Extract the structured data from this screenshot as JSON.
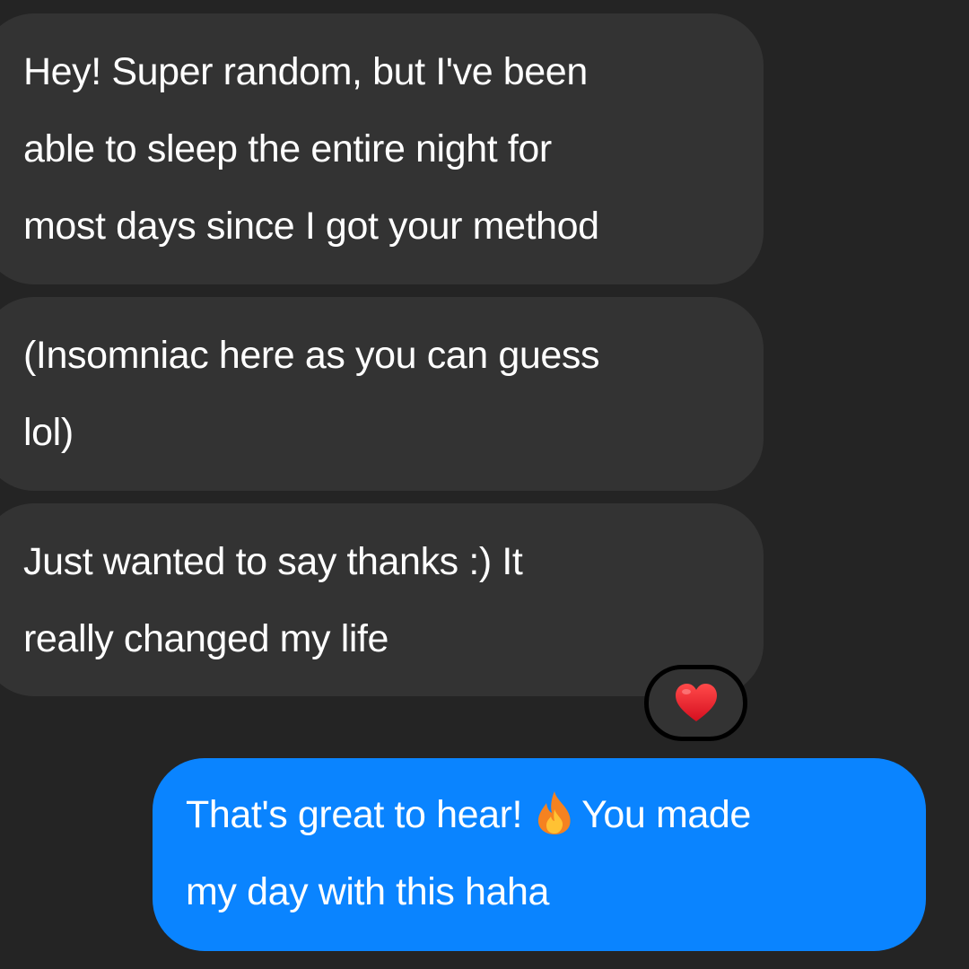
{
  "conversation": {
    "messages": [
      {
        "direction": "incoming",
        "lines": [
          "Hey! Super random, but I've been",
          "able to sleep the entire night for",
          "most days since I got your method"
        ]
      },
      {
        "direction": "incoming",
        "lines": [
          "(Insomniac here as you can guess",
          "lol)"
        ]
      },
      {
        "direction": "incoming",
        "lines": [
          "Just wanted to say thanks :) It",
          "really changed my life"
        ],
        "reaction": {
          "icon": "red-heart-icon"
        }
      },
      {
        "direction": "outgoing",
        "line1_before": "That's great to hear!",
        "line1_icon": "fire-icon",
        "line1_after": "You made",
        "line2": "my day with this haha"
      }
    ]
  },
  "colors": {
    "background": "#242424",
    "incoming_bubble": "#333333",
    "outgoing_bubble": "#0a84ff",
    "text": "#ffffff",
    "heart": "#e8192c",
    "fire": "#ff8a1e"
  }
}
